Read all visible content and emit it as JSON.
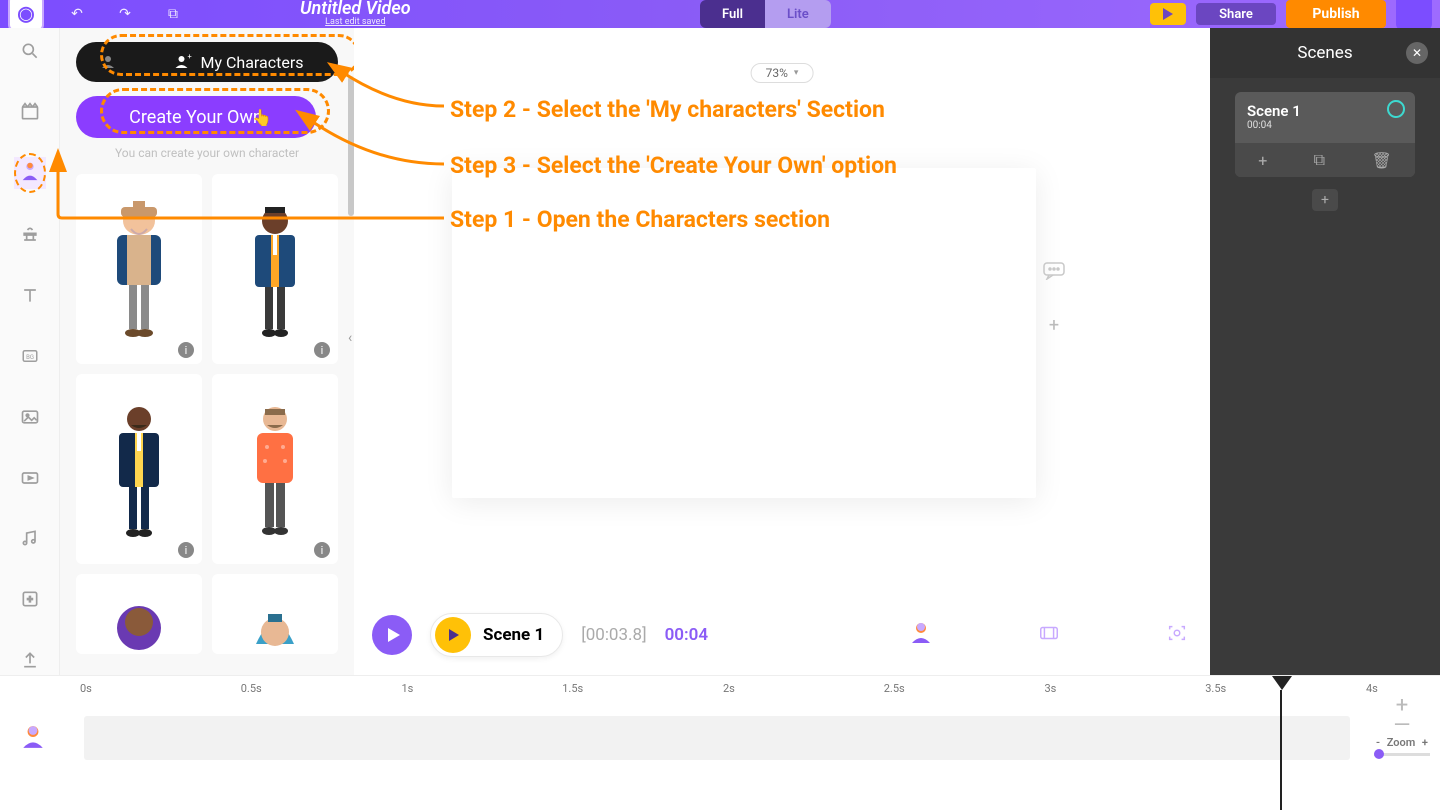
{
  "header": {
    "title": "Untitled Video",
    "subtitle": "Last edit saved",
    "mode_full": "Full",
    "mode_lite": "Lite",
    "share": "Share",
    "publish": "Publish"
  },
  "library": {
    "tab_my_characters": "My Characters",
    "create_button": "Create Your Own",
    "create_hint": "You can create your own character"
  },
  "canvas": {
    "zoom": "73%"
  },
  "annotations": {
    "step1": "Step 1 - Open the Characters section",
    "step2": "Step 2 - Select the 'My characters' Section",
    "step3": "Step 3 - Select the 'Create Your Own' option"
  },
  "playback": {
    "scene_name": "Scene 1",
    "elapsed": "[00:03.8]",
    "duration": "00:04"
  },
  "scenes_panel": {
    "title": "Scenes",
    "items": [
      {
        "name": "Scene 1",
        "duration": "00:04"
      }
    ]
  },
  "timeline": {
    "ticks": [
      "0s",
      "0.5s",
      "1s",
      "1.5s",
      "2s",
      "2.5s",
      "3s",
      "3.5s",
      "4s"
    ],
    "zoom_label": "Zoom",
    "zoom_minus": "-",
    "zoom_plus": "+"
  }
}
